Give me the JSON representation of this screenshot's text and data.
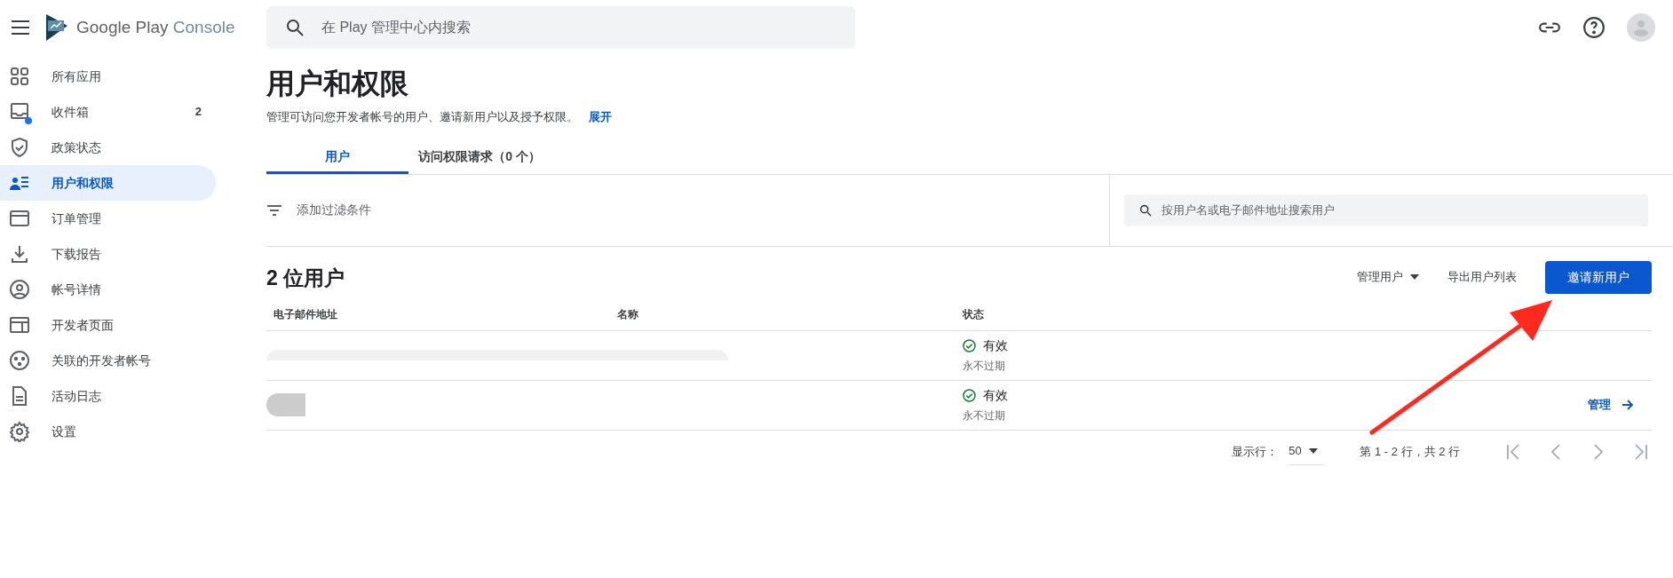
{
  "header": {
    "logo_text": "Google Play",
    "logo_suffix": "Console",
    "search": {
      "placeholder": "在 Play 管理中心内搜索"
    }
  },
  "sidebar": {
    "items": [
      {
        "label": "所有应用",
        "selected": false
      },
      {
        "label": "收件箱",
        "selected": false,
        "count": "2",
        "unread_dot": true
      },
      {
        "label": "政策状态",
        "selected": false
      },
      {
        "label": "用户和权限",
        "selected": true
      },
      {
        "label": "订单管理",
        "selected": false
      },
      {
        "label": "下载报告",
        "selected": false
      },
      {
        "label": "帐号详情",
        "selected": false
      },
      {
        "label": "开发者页面",
        "selected": false
      },
      {
        "label": "关联的开发者帐号",
        "selected": false
      },
      {
        "label": "活动日志",
        "selected": false
      },
      {
        "label": "设置",
        "selected": false
      }
    ]
  },
  "page": {
    "title": "用户和权限",
    "description": "管理可访问您开发者帐号的用户、邀请新用户以及授予权限。",
    "expand_link": "展开"
  },
  "tabs": [
    {
      "label": "用户",
      "selected": true
    },
    {
      "label": "访问权限请求（0 个）",
      "selected": false
    }
  ],
  "filter": {
    "label": "添加过滤条件"
  },
  "user_search": {
    "placeholder": "按用户名或电子邮件地址搜索用户"
  },
  "users": {
    "count_title": "2 位用户",
    "actions": {
      "manage_menu": "管理用户",
      "export": "导出用户列表",
      "invite": "邀请新用户"
    },
    "table": {
      "columns": [
        "电子邮件地址",
        "名称",
        "状态"
      ],
      "rows": [
        {
          "status": "有效",
          "expiry": "永不过期"
        },
        {
          "status": "有效",
          "expiry": "永不过期",
          "action": "管理"
        }
      ]
    }
  },
  "pagination": {
    "rows_label": "显示行：",
    "rows_value": "50",
    "range": "第 1 - 2 行，共 2 行"
  }
}
